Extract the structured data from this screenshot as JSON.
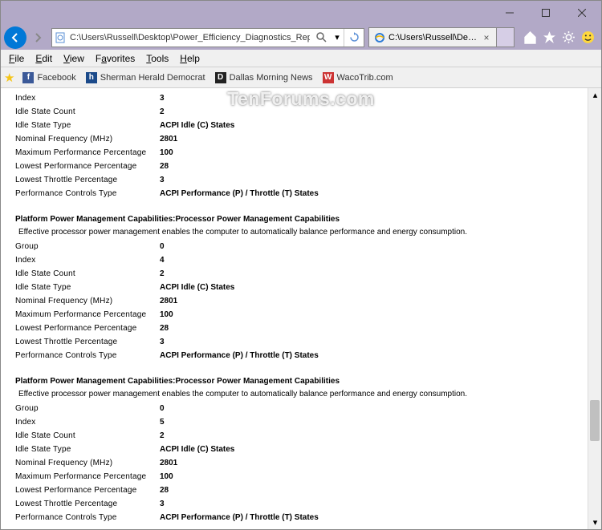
{
  "address": "C:\\Users\\Russell\\Desktop\\Power_Efficiency_Diagnostics_Report.html",
  "tab_title": "C:\\Users\\Russell\\Desktop\\P...",
  "menu": {
    "file": "File",
    "edit": "Edit",
    "view": "View",
    "favorites": "Favorites",
    "tools": "Tools",
    "help": "Help"
  },
  "bookmarks": [
    {
      "icon": "f",
      "bg": "#3b5998",
      "label": "Facebook"
    },
    {
      "icon": "h",
      "bg": "#1b4a8a",
      "label": "Sherman Herald Democrat"
    },
    {
      "icon": "D",
      "bg": "#222",
      "label": "Dallas Morning News"
    },
    {
      "icon": "W",
      "bg": "#c33",
      "label": "WacoTrib.com"
    }
  ],
  "watermark": "TenForums.com",
  "section_title": "Platform Power Management Capabilities:Processor Power Management Capabilities",
  "section_desc": "Effective processor power management enables the computer to automatically balance performance and energy consumption.",
  "blocks": [
    {
      "full": false,
      "rows": [
        [
          "Index",
          "3"
        ],
        [
          "Idle State Count",
          "2"
        ],
        [
          "Idle State Type",
          "ACPI Idle (C) States"
        ],
        [
          "Nominal Frequency (MHz)",
          "2801"
        ],
        [
          "Maximum Performance Percentage",
          "100"
        ],
        [
          "Lowest Performance Percentage",
          "28"
        ],
        [
          "Lowest Throttle Percentage",
          "3"
        ],
        [
          "Performance Controls Type",
          "ACPI Performance (P) / Throttle (T) States"
        ]
      ]
    },
    {
      "full": true,
      "rows": [
        [
          "Group",
          "0"
        ],
        [
          "Index",
          "4"
        ],
        [
          "Idle State Count",
          "2"
        ],
        [
          "Idle State Type",
          "ACPI Idle (C) States"
        ],
        [
          "Nominal Frequency (MHz)",
          "2801"
        ],
        [
          "Maximum Performance Percentage",
          "100"
        ],
        [
          "Lowest Performance Percentage",
          "28"
        ],
        [
          "Lowest Throttle Percentage",
          "3"
        ],
        [
          "Performance Controls Type",
          "ACPI Performance (P) / Throttle (T) States"
        ]
      ]
    },
    {
      "full": true,
      "rows": [
        [
          "Group",
          "0"
        ],
        [
          "Index",
          "5"
        ],
        [
          "Idle State Count",
          "2"
        ],
        [
          "Idle State Type",
          "ACPI Idle (C) States"
        ],
        [
          "Nominal Frequency (MHz)",
          "2801"
        ],
        [
          "Maximum Performance Percentage",
          "100"
        ],
        [
          "Lowest Performance Percentage",
          "28"
        ],
        [
          "Lowest Throttle Percentage",
          "3"
        ],
        [
          "Performance Controls Type",
          "ACPI Performance (P) / Throttle (T) States"
        ]
      ]
    }
  ],
  "scroll": {
    "thumb_top": "72%",
    "thumb_height": "10%"
  }
}
